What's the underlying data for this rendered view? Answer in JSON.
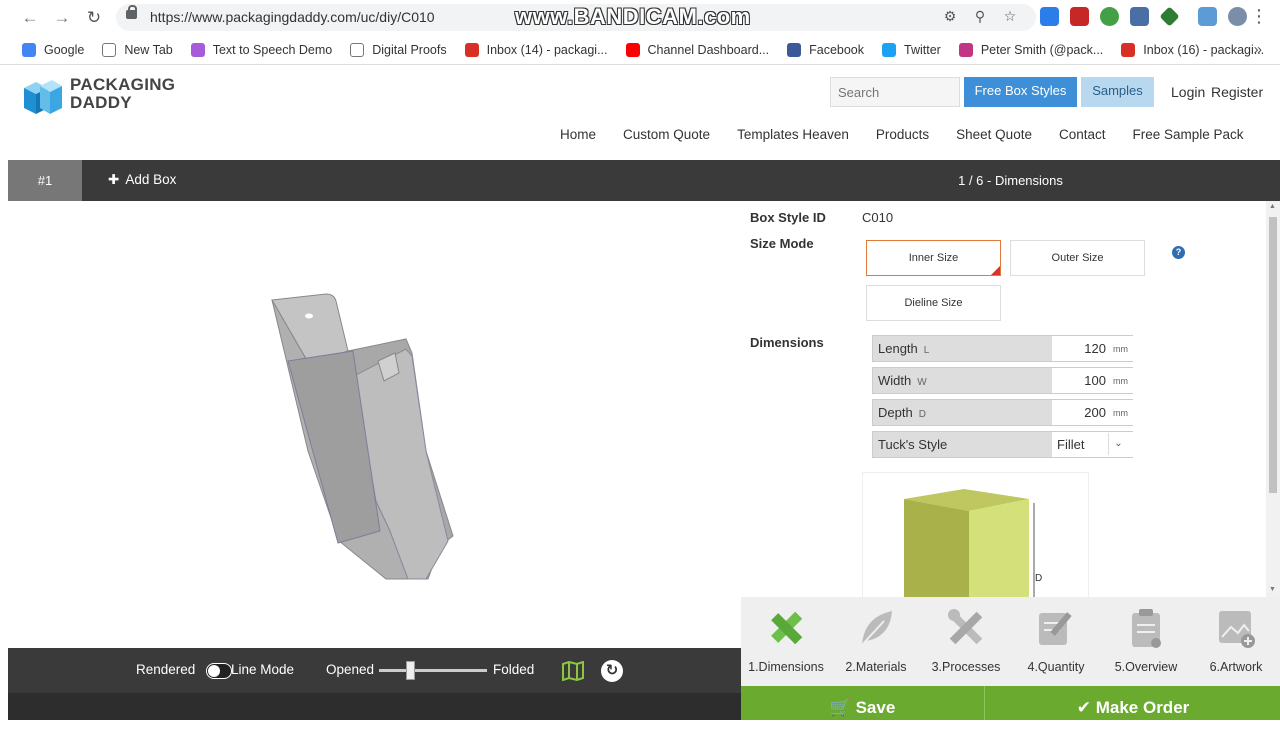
{
  "browser": {
    "url": "https://www.packagingdaddy.com/uc/diy/C010",
    "watermark": "www.BANDICAM.com",
    "bookmarks": [
      {
        "label": "Google",
        "color": "#4285f4"
      },
      {
        "label": "New Tab",
        "color": "#ffffff"
      },
      {
        "label": "Text to Speech Demo",
        "color": "#a65bd8"
      },
      {
        "label": "Digital Proofs",
        "color": "#ffffff"
      },
      {
        "label": "Inbox (14) - packagi...",
        "color": "#d93025"
      },
      {
        "label": "Channel Dashboard...",
        "color": "#ff0000"
      },
      {
        "label": "Facebook",
        "color": "#3b5998"
      },
      {
        "label": "Twitter",
        "color": "#1da1f2"
      },
      {
        "label": "Peter Smith (@pack...",
        "color": "#c13584"
      },
      {
        "label": "Inbox (16) - packagi...",
        "color": "#d93025"
      }
    ]
  },
  "header": {
    "logo_line1": "PACKAGING",
    "logo_line2": "DADDY",
    "search_placeholder": "Search",
    "free_box_styles": "Free Box Styles",
    "samples": "Samples",
    "login": "Login",
    "register": "Register",
    "nav": [
      "Home",
      "Custom Quote",
      "Templates Heaven",
      "Products",
      "Sheet Quote",
      "Contact",
      "Free Sample Pack"
    ]
  },
  "tabs": {
    "active_tab": "#1",
    "add_box": "Add Box"
  },
  "step_header": "1 / 6 - Dimensions",
  "viewer": {
    "rendered": "Rendered",
    "line_mode": "Line Mode",
    "opened": "Opened",
    "folded": "Folded"
  },
  "form": {
    "box_style_label": "Box Style ID",
    "box_style_value": "C010",
    "size_mode_label": "Size Mode",
    "inner_size": "Inner Size",
    "outer_size": "Outer Size",
    "dieline_size": "Dieline Size",
    "dimensions_label": "Dimensions",
    "length": {
      "label": "Length",
      "sub": "L",
      "value": "120",
      "unit": "mm"
    },
    "width": {
      "label": "Width",
      "sub": "W",
      "value": "100",
      "unit": "mm"
    },
    "depth": {
      "label": "Depth",
      "sub": "D",
      "value": "200",
      "unit": "mm"
    },
    "tuck": {
      "label": "Tuck's Style",
      "value": "Fillet"
    },
    "preview_dim_label": "D"
  },
  "steps": [
    {
      "label": "1.Dimensions",
      "icon": "ruler-pencil-icon",
      "active": true
    },
    {
      "label": "2.Materials",
      "icon": "leaf-icon",
      "active": false
    },
    {
      "label": "3.Processes",
      "icon": "tools-icon",
      "active": false
    },
    {
      "label": "4.Quantity",
      "icon": "edit-icon",
      "active": false
    },
    {
      "label": "5.Overview",
      "icon": "clipboard-icon",
      "active": false
    },
    {
      "label": "6.Artwork",
      "icon": "image-add-icon",
      "active": false
    }
  ],
  "actions": {
    "save": "Save",
    "make_order": "Make Order"
  },
  "colors": {
    "primary_blue": "#3d8fd8",
    "action_green": "#6aaa2e",
    "dark_bar": "#3a3a3a",
    "active_step": "#6cc04a"
  }
}
